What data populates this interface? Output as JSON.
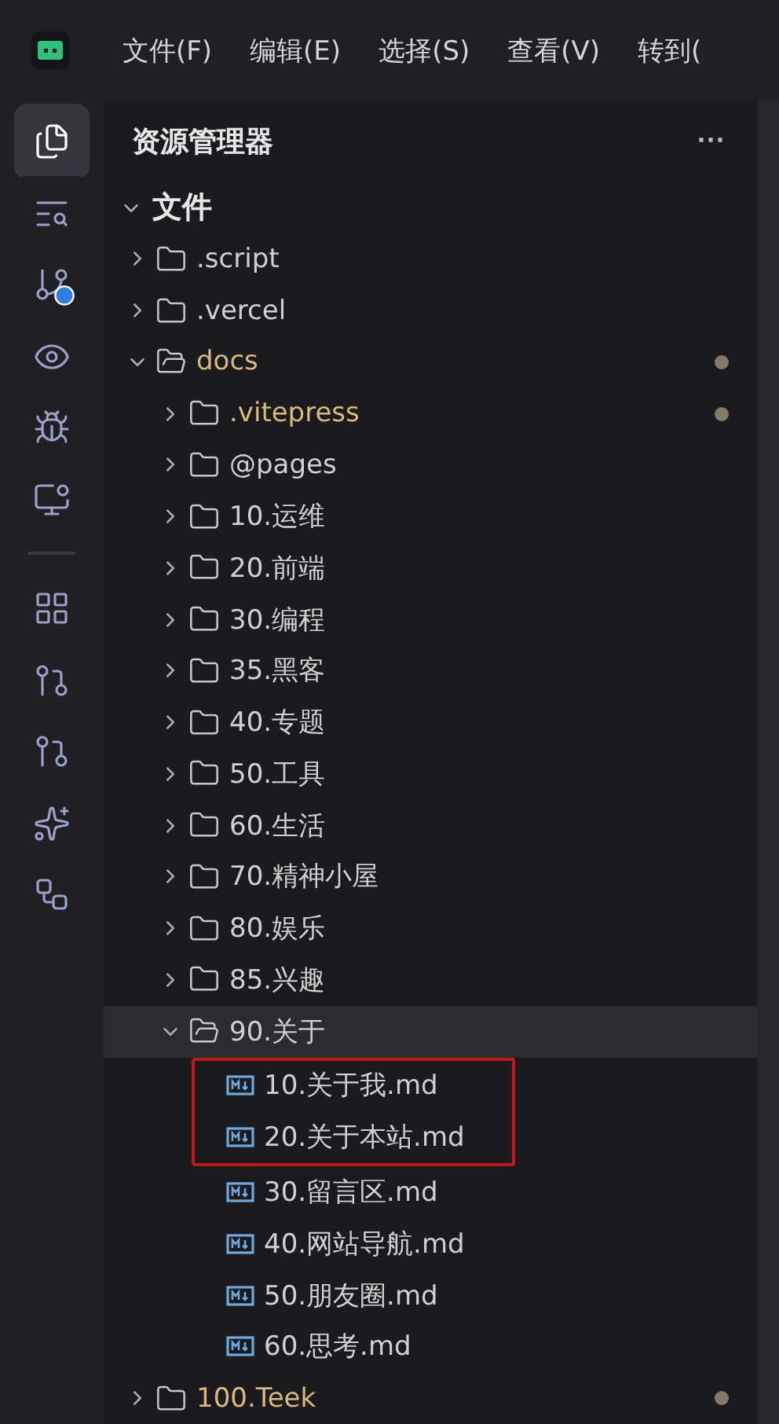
{
  "menu": [
    {
      "label": "文件(F)"
    },
    {
      "label": "编辑(E)"
    },
    {
      "label": "选择(S)"
    },
    {
      "label": "查看(V)"
    },
    {
      "label": "转到("
    }
  ],
  "activity_bar": [
    {
      "kind": "files",
      "selected": true
    },
    {
      "kind": "search",
      "selected": false
    },
    {
      "kind": "git",
      "selected": false
    },
    {
      "kind": "eye",
      "selected": false
    },
    {
      "kind": "bug",
      "selected": false
    },
    {
      "kind": "remote",
      "selected": false
    },
    {
      "kind": "divider"
    },
    {
      "kind": "grid",
      "selected": false
    },
    {
      "kind": "pr",
      "selected": false
    },
    {
      "kind": "pr2",
      "selected": false
    },
    {
      "kind": "spark",
      "selected": false
    },
    {
      "kind": "nodes",
      "selected": false
    }
  ],
  "explorer": {
    "title": "资源管理器",
    "more": "···",
    "section": {
      "label": "文件",
      "expanded": true
    },
    "tree": [
      {
        "kind": "folder",
        "name": ".script",
        "expanded": false,
        "modified": false,
        "selected": false
      },
      {
        "kind": "folder",
        "name": ".vercel",
        "expanded": false,
        "modified": false,
        "selected": false
      },
      {
        "kind": "folder",
        "name": "docs",
        "expanded": true,
        "modified": true,
        "selected": false,
        "children": [
          {
            "kind": "folder",
            "name": ".vitepress",
            "expanded": false,
            "modified": true,
            "selected": false
          },
          {
            "kind": "folder",
            "name": "@pages",
            "expanded": false,
            "modified": false,
            "selected": false
          },
          {
            "kind": "folder",
            "name": "10.运维",
            "expanded": false,
            "modified": false,
            "selected": false
          },
          {
            "kind": "folder",
            "name": "20.前端",
            "expanded": false,
            "modified": false,
            "selected": false
          },
          {
            "kind": "folder",
            "name": "30.编程",
            "expanded": false,
            "modified": false,
            "selected": false
          },
          {
            "kind": "folder",
            "name": "35.黑客",
            "expanded": false,
            "modified": false,
            "selected": false
          },
          {
            "kind": "folder",
            "name": "40.专题",
            "expanded": false,
            "modified": false,
            "selected": false
          },
          {
            "kind": "folder",
            "name": "50.工具",
            "expanded": false,
            "modified": false,
            "selected": false
          },
          {
            "kind": "folder",
            "name": "60.生活",
            "expanded": false,
            "modified": false,
            "selected": false
          },
          {
            "kind": "folder",
            "name": "70.精神小屋",
            "expanded": false,
            "modified": false,
            "selected": false
          },
          {
            "kind": "folder",
            "name": "80.娱乐",
            "expanded": false,
            "modified": false,
            "selected": false
          },
          {
            "kind": "folder",
            "name": "85.兴趣",
            "expanded": false,
            "modified": false,
            "selected": false
          },
          {
            "kind": "folder",
            "name": "90.关于",
            "expanded": true,
            "modified": false,
            "selected": true,
            "children": [
              {
                "kind": "file",
                "name": "10.关于我.md",
                "boxed": true,
                "selected": false
              },
              {
                "kind": "file",
                "name": "20.关于本站.md",
                "boxed": true,
                "selected": false
              },
              {
                "kind": "file",
                "name": "30.留言区.md",
                "boxed": false,
                "selected": false
              },
              {
                "kind": "file",
                "name": "40.网站导航.md",
                "boxed": false,
                "selected": false
              },
              {
                "kind": "file",
                "name": "50.朋友圈.md",
                "boxed": false,
                "selected": false
              },
              {
                "kind": "file",
                "name": "60.思考.md",
                "boxed": false,
                "selected": false
              }
            ]
          }
        ]
      },
      {
        "kind": "folder",
        "name": "100.Teek",
        "expanded": false,
        "modified": true,
        "selected": false
      }
    ]
  }
}
